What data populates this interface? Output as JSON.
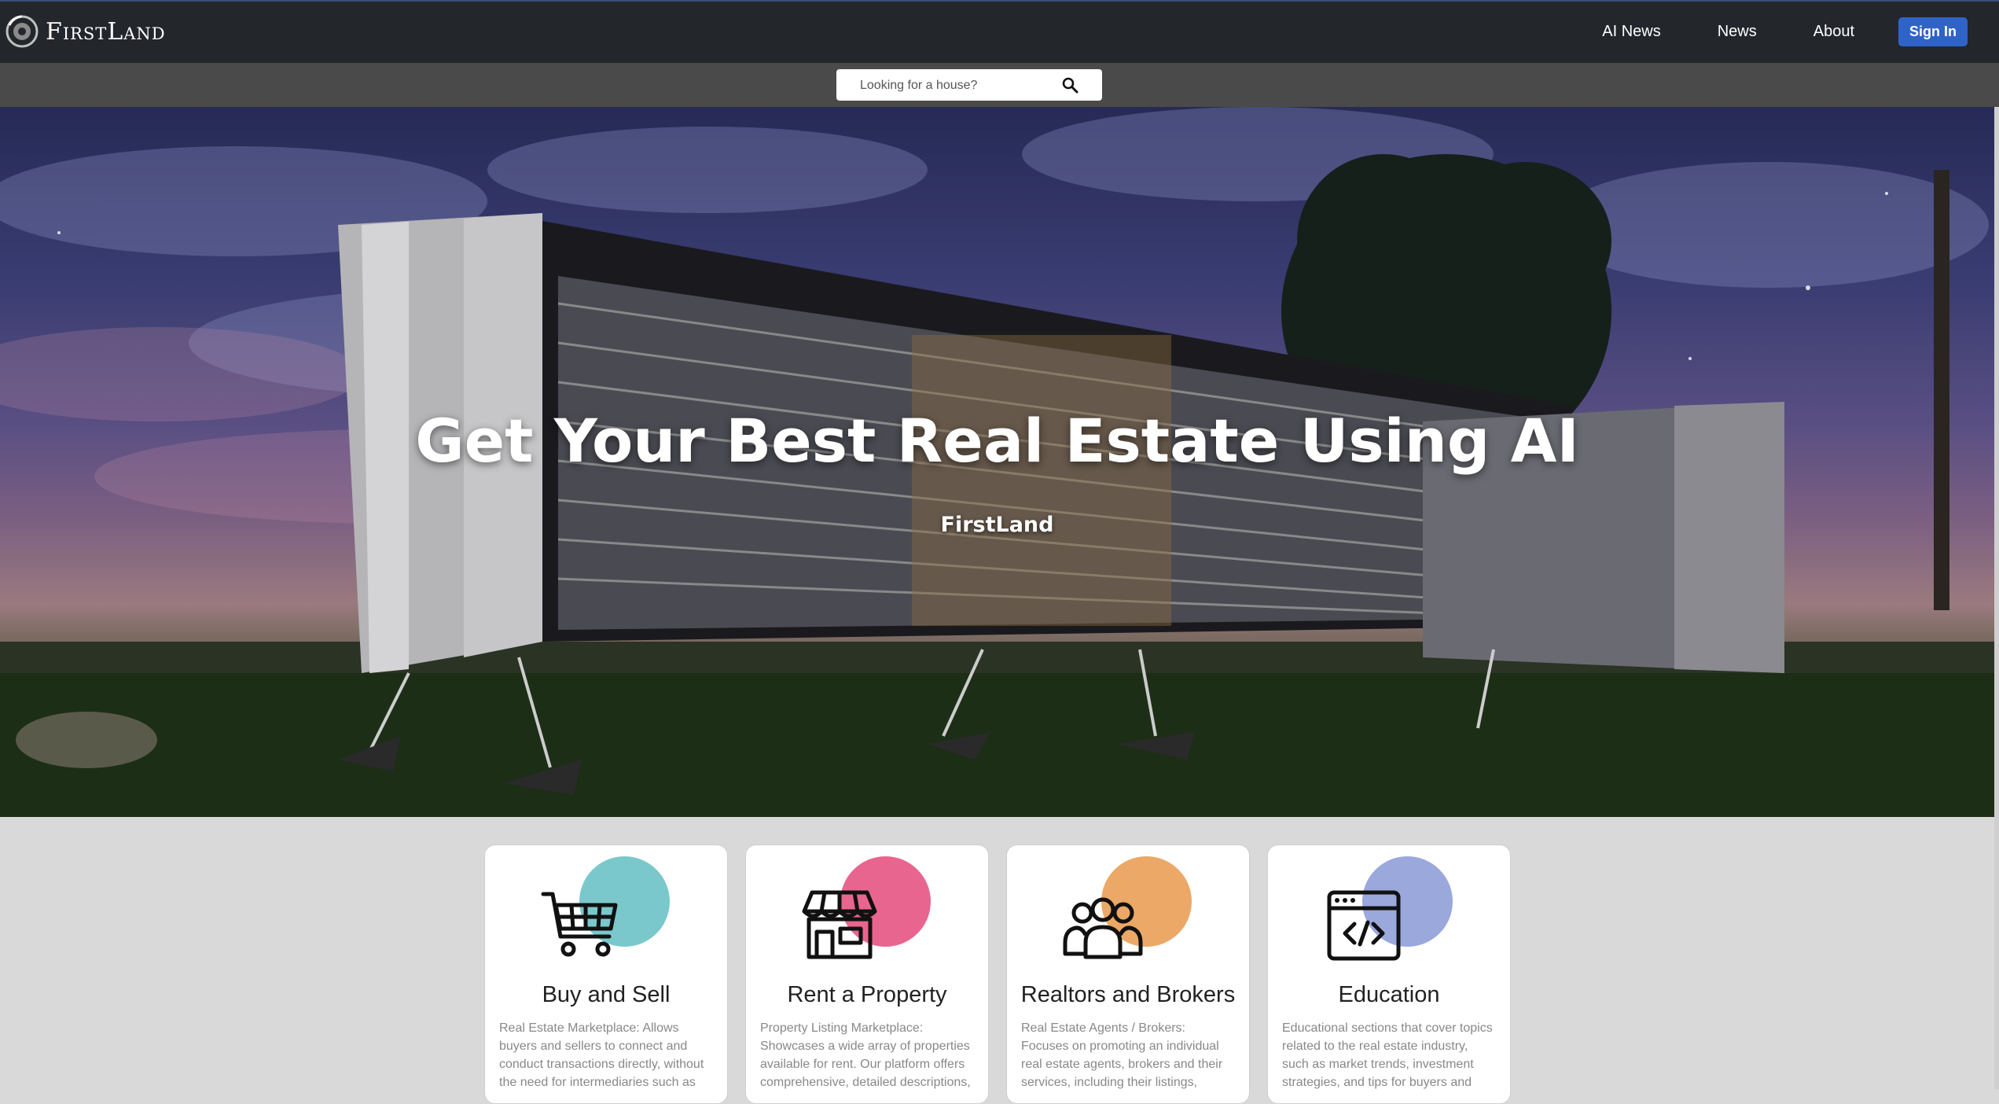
{
  "brand": {
    "name": "FirstLand"
  },
  "nav": {
    "links": [
      "AI News",
      "News",
      "About"
    ],
    "signin_label": "Sign In"
  },
  "search": {
    "placeholder": "Looking for a house?"
  },
  "hero": {
    "title": "Get Your Best Real Estate Using AI",
    "subtitle": "FirstLand"
  },
  "cards": [
    {
      "title": "Buy and Sell",
      "icon": "shopping-cart-icon",
      "color": "#7ac8cc",
      "description": "Real Estate Marketplace: Allows buyers and sellers to connect and conduct transactions directly, without the need for intermediaries such as"
    },
    {
      "title": "Rent a Property",
      "icon": "storefront-icon",
      "color": "#e8658f",
      "description": "Property Listing Marketplace: Showcases a wide array of properties available for rent. Our platform offers comprehensive, detailed descriptions,"
    },
    {
      "title": "Realtors and Brokers",
      "icon": "group-people-icon",
      "color": "#eba866",
      "description": "Real Estate Agents / Brokers: Focuses on promoting an individual real estate agents, brokers and their services, including their listings,"
    },
    {
      "title": "Education",
      "icon": "code-window-icon",
      "color": "#9aa8dc",
      "description": "Educational sections that cover topics related to the real estate industry, such as market trends, investment strategies, and tips for buyers and"
    }
  ],
  "colors": {
    "navbar_bg": "#23262b",
    "searchbar_bg": "#4a4a4a",
    "signin_bg": "#2f63c8",
    "page_bg": "#d9d9d9"
  }
}
